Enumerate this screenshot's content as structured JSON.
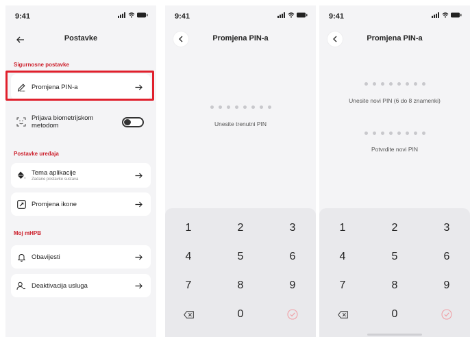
{
  "status_time": "9:41",
  "screen1": {
    "title": "Postavke",
    "sections": {
      "security": "Sigurnosne postavke",
      "device": "Postavke uređaja",
      "account": "Moj mHPB"
    },
    "items": {
      "pin": "Promjena PIN-a",
      "biometric": "Prijava biometrijskom metodom",
      "theme": "Tema aplikacije",
      "theme_sub": "Zadane postavke sustava",
      "icon": "Promjena ikone",
      "notifications": "Obavijesti",
      "deactivate": "Deaktivacija usluga"
    },
    "biometric_enabled": false
  },
  "screen2": {
    "title": "Promjena PIN-a",
    "prompt": "Unesite trenutni PIN",
    "pin_slots": 8
  },
  "screen3": {
    "title": "Promjena PIN-a",
    "prompt_new": "Unesite novi PIN (6 do 8 znamenki)",
    "prompt_confirm": "Potvrdite novi PIN",
    "pin_slots": 8
  },
  "keypad": {
    "keys": [
      "1",
      "2",
      "3",
      "4",
      "5",
      "6",
      "7",
      "8",
      "9",
      "0"
    ],
    "delete_icon": "backspace-icon",
    "confirm_icon": "check-circle-icon"
  },
  "colors": {
    "accent": "#cc1f2b",
    "highlight": "#e0202c",
    "background": "#f4f4f6",
    "keypad": "#e9e9ec"
  }
}
